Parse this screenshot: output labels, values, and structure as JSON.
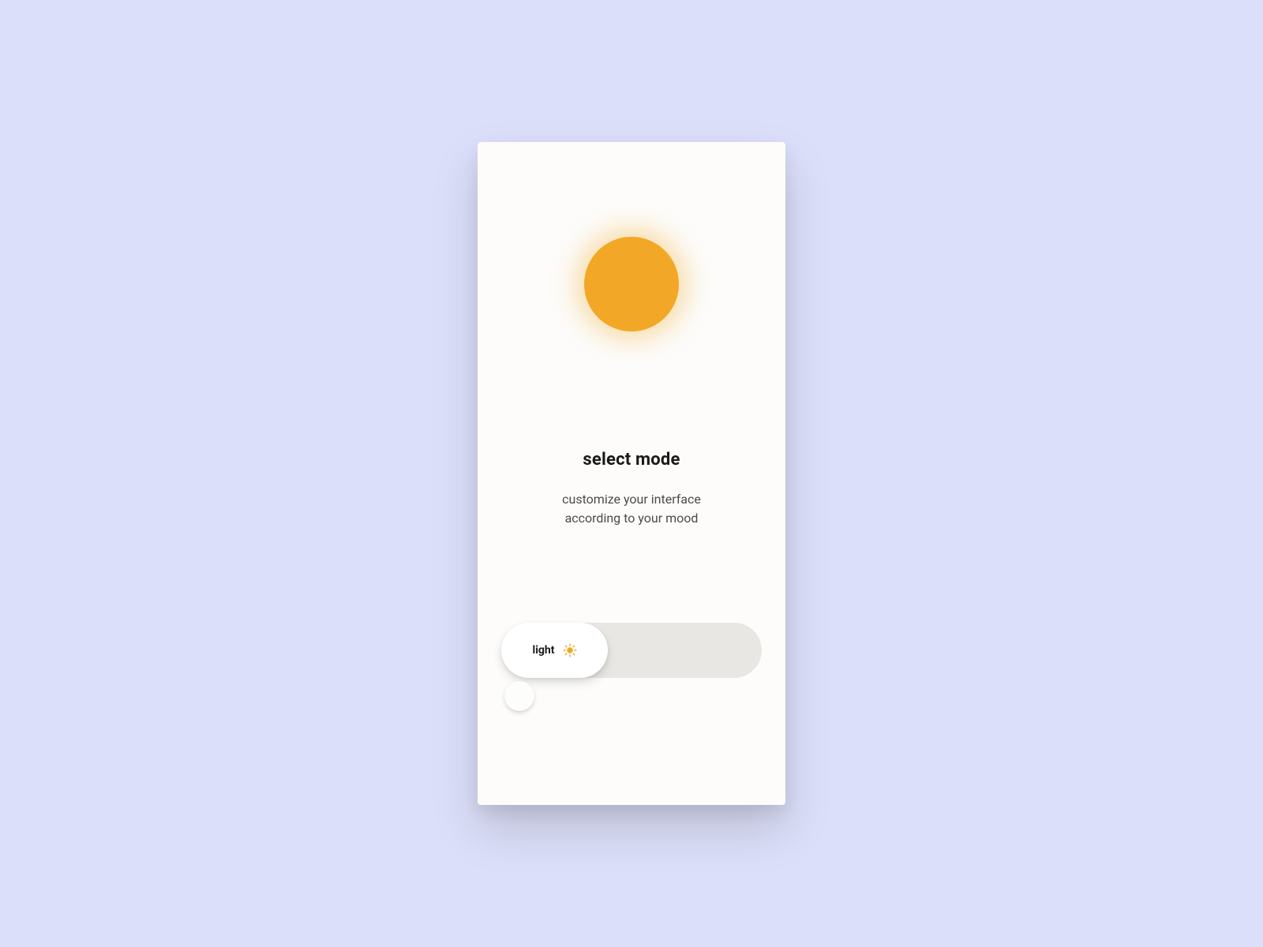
{
  "heading": "select mode",
  "subheading_line1": "customize your interface",
  "subheading_line2": "according to your mood",
  "toggle": {
    "selected_label": "light"
  },
  "colors": {
    "accent": "#f2a826",
    "background": "#dcdff9",
    "card": "#fdfcfa",
    "track": "#e9e7e3"
  }
}
